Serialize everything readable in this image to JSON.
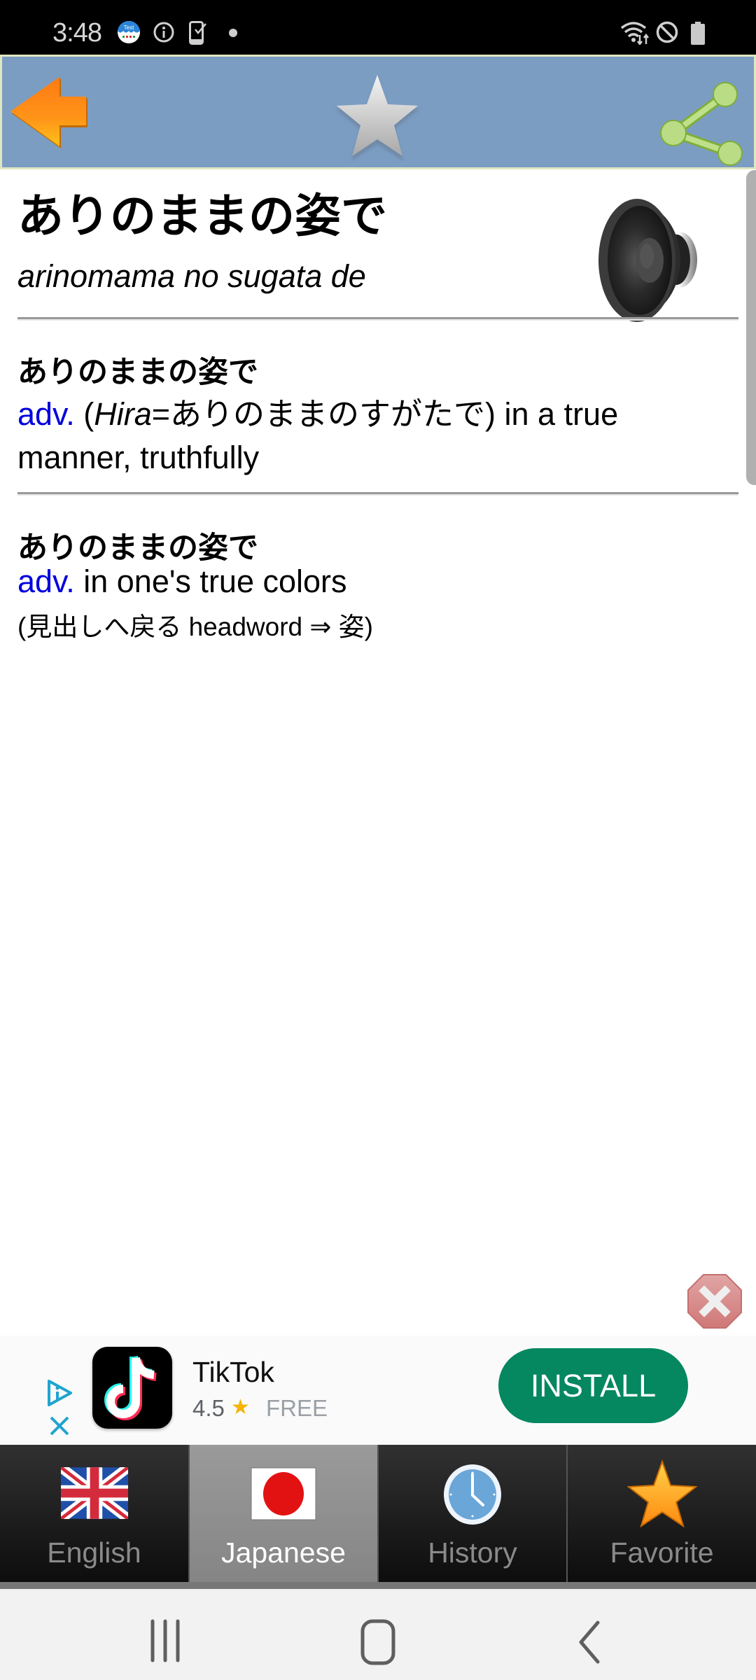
{
  "status_bar": {
    "time": "3:48",
    "notification_icons": [
      "test-app-icon",
      "info-icon",
      "phone-check-icon",
      "dot-icon"
    ],
    "system_icons": [
      "wifi-icon",
      "do-not-disturb-icon",
      "battery-icon"
    ],
    "test_app_label": "Test"
  },
  "toolbar": {
    "back_icon": "orange-left-arrow",
    "favorite_icon": "gray-star",
    "share_icon": "green-share"
  },
  "entry": {
    "headword": "ありのままの姿で",
    "romaji": "arinomama no sugata de",
    "speaker_icon": "speaker-icon",
    "senses": [
      {
        "heading": "ありのままの姿で",
        "pos": "adv.",
        "line1_prefix": "(",
        "hira_label": "Hira",
        "line1_rest": "=ありのままのすがたで) in a true",
        "line2": "manner, truthfully"
      },
      {
        "heading": "ありのままの姿で",
        "pos": "adv.",
        "definition": "in one's true colors",
        "note": "(見出しへ戻る headword ⇒ 姿)"
      }
    ]
  },
  "ad": {
    "app_name": "TikTok",
    "rating": "4.5",
    "price": "FREE",
    "install_label": "INSTALL",
    "colors": {
      "install_bg": "#05875f",
      "star": "#f5b400"
    }
  },
  "tabs": [
    {
      "label": "English",
      "icon": "uk-flag-icon",
      "active": false
    },
    {
      "label": "Japanese",
      "icon": "japan-flag-icon",
      "active": true
    },
    {
      "label": "History",
      "icon": "clock-icon",
      "active": false
    },
    {
      "label": "Favorite",
      "icon": "star-icon",
      "active": false
    }
  ],
  "nav": {
    "recents": "recent-apps",
    "home": "home",
    "back": "back"
  }
}
